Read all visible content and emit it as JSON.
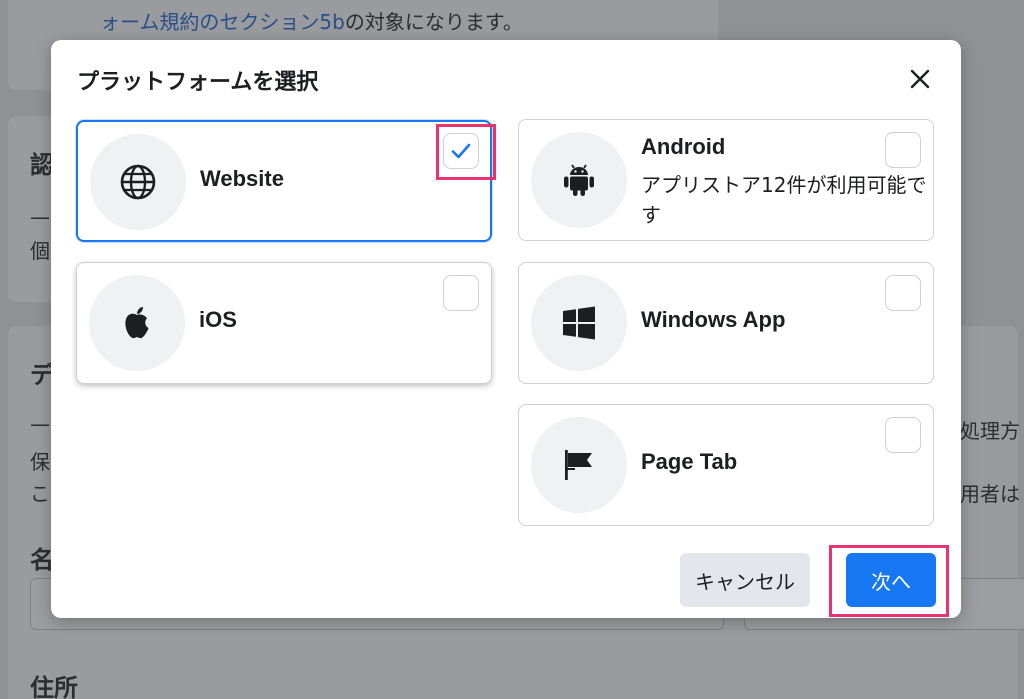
{
  "background": {
    "top_link": "ォーム規約のセクション5b",
    "top_text": "の対象になります。",
    "left_heading_1": "認",
    "left_line_1": "—",
    "left_line_2": "個",
    "left_heading_2": "デ",
    "left_line_3": "—",
    "left_line_4": "保",
    "left_line_5": "こ",
    "left_label_name": "名",
    "left_heading_3": "住所",
    "right_text_1": "の処理方",
    "right_text_2": "利用者は"
  },
  "modal": {
    "title": "プラットフォームを選択",
    "close_icon": "close-icon",
    "platforms": [
      {
        "label": "Website",
        "subtitle": "",
        "icon": "globe-icon",
        "checked": true
      },
      {
        "label": "Android",
        "subtitle": "アプリストア12件が利用可能です",
        "icon": "android-icon",
        "checked": false
      },
      {
        "label": "iOS",
        "subtitle": "",
        "icon": "apple-icon",
        "checked": false
      },
      {
        "label": "Windows App",
        "subtitle": "",
        "icon": "windows-icon",
        "checked": false
      },
      {
        "label": "Page Tab",
        "subtitle": "",
        "icon": "page-flag-icon",
        "checked": false
      }
    ],
    "cancel_label": "キャンセル",
    "next_label": "次へ",
    "colors": {
      "primary": "#1877f2",
      "highlight": "#e8336f"
    }
  }
}
